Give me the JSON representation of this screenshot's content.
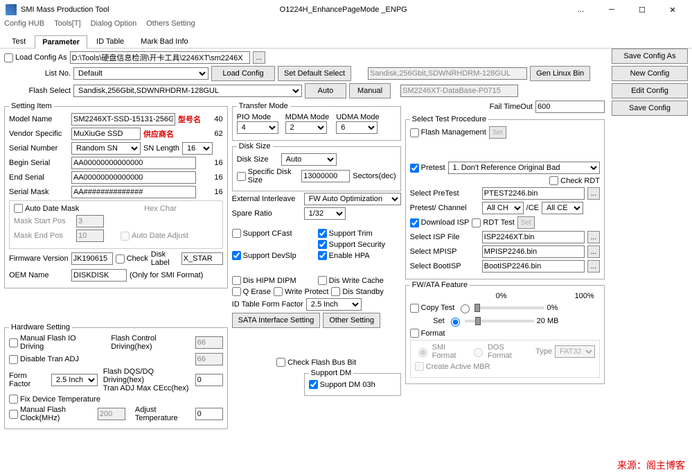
{
  "title": "SMI Mass Production Tool",
  "centerTitle": "O1224H_EnhancePageMode    _ENPG",
  "ellipsis": "...",
  "menu": {
    "config": "Config HUB",
    "tools": "Tools[T]",
    "dialog": "Dialog Option",
    "others": "Others Setting"
  },
  "tabs": {
    "test": "Test",
    "parameter": "Parameter",
    "id": "ID Table",
    "bad": "Mark Bad Info"
  },
  "top": {
    "loadConfigAs": "Load Config As",
    "configPath": "D:\\Tools\\硬盘信息检测\\开卡工具\\2246XT\\sm2246X",
    "listNo": "List No.",
    "listNoVal": "Default",
    "loadConfig": "Load Config",
    "setDefault": "Set Default Select",
    "flashSel": "Flash Select",
    "flashVal": "Sandisk,256Gbit,SDWNRHDRM-128GUL",
    "auto": "Auto",
    "manual": "Manual",
    "bankInfo": "Sandisk,256Gbit,SDWNRHDRM-128GUL",
    "db": "SM2246XT-DataBase-P0715",
    "genLinux": "Gen Linux Bin",
    "failTimeout": "Fail TimeOut",
    "failTimeoutVal": "600",
    "btns": {
      "saveAs": "Save Config As",
      "new": "New Config",
      "edit": "Edit Config",
      "save": "Save Config"
    }
  },
  "setting": {
    "legend": "Setting Item",
    "modelName": "Model Name",
    "modelVal": "SM2246XT-SSD-15131-256G",
    "modelNote": "型号名",
    "modelLen": "40",
    "vendor": "Vendor Specific",
    "vendorVal": "MuXiuGe SSD",
    "vendorNote": "供应商名",
    "vendorLen": "62",
    "serialNum": "Serial Number",
    "serialVal": "Random SN",
    "snLen": "SN Length",
    "snLenVal": "16",
    "beginSerial": "Begin Serial",
    "beginVal": "AA00000000000000",
    "beginLen": "16",
    "endSerial": "End Serial",
    "endVal": "AA00000000000000",
    "endLen": "16",
    "serialMask": "Serial Mask",
    "maskVal": "AA##############",
    "maskLen": "16",
    "autoDate": "Auto Date Mask",
    "hexChar": "Hex Char",
    "maskStart": "Mask Start Pos",
    "maskStartVal": "3",
    "maskEnd": "Mask End Pos",
    "maskEndVal": "10",
    "autoAdj": "Auto Date Adjust",
    "fwVer": "Firmware Version",
    "fwVal": "JK190615",
    "check": "Check",
    "diskLabel": "Disk Label",
    "diskLabelVal": "X_STAR",
    "oem": "OEM Name",
    "oemVal": "DISKDISK",
    "oemNote": "(Only for SMI Format)"
  },
  "transfer": {
    "legend": "Transfer Mode",
    "pio": "PIO Mode",
    "pioVal": "4",
    "mdma": "MDMA Mode",
    "mdmaVal": "2",
    "udma": "UDMA Mode",
    "udmaVal": "6"
  },
  "disk": {
    "legend": "Disk Size",
    "diskSize": "Disk Size",
    "diskVal": "Auto",
    "specific": "Specific Disk Size",
    "specVal": "13000000",
    "sectors": "Sectors(dec)",
    "extInt": "External Interleave",
    "extVal": "FW Auto Optimization",
    "spare": "Spare Ratio",
    "spareVal": "1/32",
    "cfast": "Support CFast",
    "trim": "Support Trim",
    "sec": "Support Security",
    "devslp": "Support DevSlp",
    "hpa": "Enable HPA",
    "disHipm": "Dis HIPM DIPM",
    "disCache": "Dis Write Cache",
    "qErase": "Q Erase",
    "wprot": "Write Protect",
    "standby": "Dis Standby",
    "formFactor": "ID Table Form Factor",
    "ffVal": "2.5 Inch",
    "sataBtn": "SATA Interface Setting",
    "otherBtn": "Other Setting"
  },
  "hw": {
    "legend": "Hardware Setting",
    "manualIO": "Manual Flash IO Driving",
    "disTran": "Disable Tran ADJ",
    "flashCtrl": "Flash Control Driving(hex)",
    "flashCtrlVal": "66",
    "val66": "66",
    "formFactor": "Form Factor",
    "ffVal": "2.5 Inch",
    "dqs": "Flash DQS/DQ Driving(hex)",
    "cecc": "Tran ADJ Max CEcc(hex)",
    "ceccVal": "0",
    "fixTemp": "Fix Device Temperature",
    "manualClk": "Manual Flash Clock(MHz)",
    "clkVal": "200",
    "adjTemp": "Adjust Temperature",
    "adjVal": "0",
    "checkBus": "Check Flash Bus Bit",
    "supportDM": "Support DM",
    "supportDM03": "Support DM 03h"
  },
  "test": {
    "legend": "Select Test Procedure",
    "flashMgmt": "Flash Management",
    "set": "Set",
    "pretest": "Pretest",
    "pretestVal": "1. Don't Reference Original Bad",
    "checkRDT": "Check RDT",
    "selPretest": "Select PreTest",
    "selPretestVal": "PTEST2246.bin",
    "preChannel": "Pretest/ Channel",
    "chVal": "All CH",
    "ce": "/CE",
    "ceVal": "All CE",
    "dlISP": "Download ISP",
    "rdt": "RDT Test",
    "selISP": "Select ISP File",
    "ispVal": "ISP2246XT.bin",
    "selMP": "Select MPISP",
    "mpVal": "MPISP2246.bin",
    "selBoot": "Select BootISP",
    "bootVal": "BootISP2246.bin"
  },
  "fw": {
    "legend": "FW/ATA Feature",
    "copy": "Copy Test",
    "set": "Set",
    "p0": "0%",
    "p100": "100%",
    "mb": "20 MB",
    "format": "Format",
    "smi": "SMI Format",
    "dos": "DOS Format",
    "type": "Type",
    "typeVal": "FAT32",
    "mbr": "Create Active MBR"
  },
  "watermark": "来源：阁主博客"
}
